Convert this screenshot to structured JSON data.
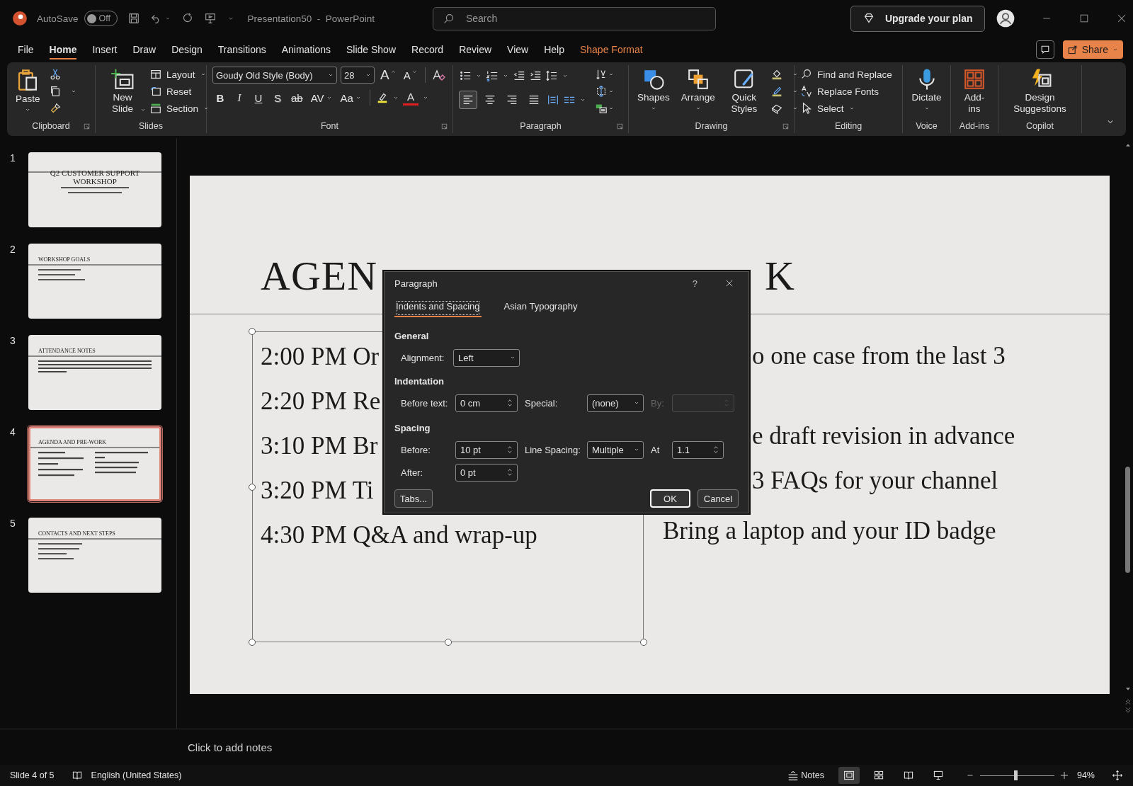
{
  "titlebar": {
    "autosave_label": "AutoSave",
    "autosave": {
      "on": false,
      "label": "Off"
    },
    "document_title": "Presentation50  -  PowerPoint",
    "search": {
      "placeholder": "Search"
    },
    "upgrade_button": "Upgrade your plan"
  },
  "menu_tabs": [
    {
      "label": "File",
      "selected": false,
      "kind": "plain"
    },
    {
      "label": "Home",
      "selected": true,
      "kind": "plain"
    },
    {
      "label": "Insert",
      "selected": false,
      "kind": "plain"
    },
    {
      "label": "Draw",
      "selected": false,
      "kind": "plain"
    },
    {
      "label": "Design",
      "selected": false,
      "kind": "plain"
    },
    {
      "label": "Transitions",
      "selected": false,
      "kind": "plain"
    },
    {
      "label": "Animations",
      "selected": false,
      "kind": "plain"
    },
    {
      "label": "Slide Show",
      "selected": false,
      "kind": "plain"
    },
    {
      "label": "Record",
      "selected": false,
      "kind": "plain"
    },
    {
      "label": "Review",
      "selected": false,
      "kind": "plain"
    },
    {
      "label": "View",
      "selected": false,
      "kind": "plain"
    },
    {
      "label": "Help",
      "selected": false,
      "kind": "plain"
    },
    {
      "label": "Shape Format",
      "selected": false,
      "kind": "contextual"
    }
  ],
  "share_button": "Share",
  "ribbon": {
    "clipboard": {
      "label": "Clipboard",
      "paste": "Paste"
    },
    "slides": {
      "label": "Slides",
      "new_slide": "New Slide",
      "layout": "Layout",
      "reset": "Reset",
      "section": "Section"
    },
    "font": {
      "label": "Font",
      "family": "Goudy Old Style (Body)",
      "size": "28",
      "grow": "A",
      "shrink": "A",
      "styles": [
        {
          "kind": "bold",
          "label": "B"
        },
        {
          "kind": "italic",
          "label": "I"
        },
        {
          "kind": "underline",
          "label": "U"
        },
        {
          "kind": "shadow",
          "label": "S"
        },
        {
          "kind": "strike",
          "label": "ab"
        },
        {
          "kind": "spacing",
          "label": "AV"
        },
        {
          "kind": "case",
          "label": "Aa"
        }
      ],
      "font_color_button": "A"
    },
    "paragraph": {
      "label": "Paragraph",
      "alignments": [
        {
          "kind": "left",
          "selected": true
        },
        {
          "kind": "center",
          "selected": false
        },
        {
          "kind": "right",
          "selected": false
        },
        {
          "kind": "justify",
          "selected": false
        }
      ]
    },
    "drawing": {
      "label": "Drawing",
      "shapes": "Shapes",
      "arrange": "Arrange",
      "quick_styles": "Quick Styles"
    },
    "editing": {
      "label": "Editing",
      "find": "Find and Replace",
      "replace_fonts": "Replace Fonts",
      "select": "Select"
    },
    "voice": {
      "label": "Voice",
      "dictate": "Dictate"
    },
    "addins": {
      "label": "Add-ins",
      "addins": "Add-ins"
    },
    "copilot": {
      "label": "Copilot",
      "design": "Design Suggestions"
    }
  },
  "slide_thumbnails": [
    {
      "number": "1",
      "selected": false,
      "kind": "title",
      "title": "Q2 CUSTOMER SUPPORT WORKSHOP"
    },
    {
      "number": "2",
      "selected": false,
      "kind": "brief",
      "title": "WORKSHOP GOALS"
    },
    {
      "number": "3",
      "selected": false,
      "kind": "paragraph",
      "title": "ATTENDANCE NOTES"
    },
    {
      "number": "4",
      "selected": true,
      "kind": "agenda",
      "title": "AGENDA AND PRE-WORK"
    },
    {
      "number": "5",
      "selected": false,
      "kind": "list",
      "title": "CONTACTS AND NEXT STEPS"
    }
  ],
  "slide": {
    "title_left": "AGEN",
    "title_right": "K",
    "left_items": [
      "2:00 PM Or",
      "2:20 PM Re",
      "3:10 PM Br",
      "3:20 PM Ti",
      "4:30 PM Q&A and wrap-up"
    ],
    "right_beside_dialog": [
      "o one case from the last 3",
      "e draft revision in advance",
      "3 FAQs for your channel"
    ],
    "right_below_dialog": [
      "Bring a laptop and your ID badge"
    ]
  },
  "notes": {
    "prompt": "Click to add notes"
  },
  "dialog": {
    "title": "Paragraph",
    "help": "?",
    "tabs": [
      {
        "label": "Indents and Spacing",
        "selected": true
      },
      {
        "label": "Asian Typography",
        "selected": false
      }
    ],
    "general": {
      "heading": "General",
      "alignment_label": "Alignment:",
      "alignment": "Left"
    },
    "indentation": {
      "heading": "Indentation",
      "before_text_label": "Before text:",
      "before_text": "0 cm",
      "special_label": "Special:",
      "special": "(none)",
      "by_label": "By:",
      "by_disabled": true
    },
    "spacing": {
      "heading": "Spacing",
      "before_label": "Before:",
      "before": "10 pt",
      "line_spacing_label": "Line Spacing:",
      "line_spacing": "Multiple",
      "at_label": "At",
      "at": "1.1",
      "after_label": "After:",
      "after": "0 pt"
    },
    "buttons": {
      "tabs": "Tabs...",
      "ok": "OK",
      "cancel": "Cancel"
    }
  },
  "status_bar": {
    "slide": "Slide 4 of 5",
    "language": "English (United States)",
    "notes": "Notes",
    "views": [
      {
        "kind": "normal",
        "selected": true
      },
      {
        "kind": "sorter",
        "selected": false
      },
      {
        "kind": "reading",
        "selected": false
      },
      {
        "kind": "slideshow",
        "selected": false
      }
    ],
    "zoom": {
      "level": 0.48
    },
    "zoom_text": "94%"
  }
}
